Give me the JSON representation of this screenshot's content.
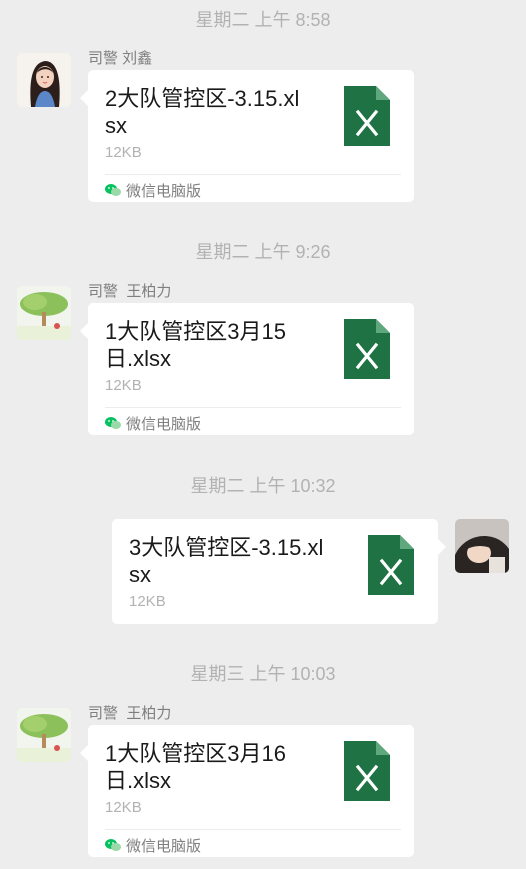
{
  "messages": [
    {
      "timestamp": "星期二 上午 8:58",
      "sender": "司警 刘鑫",
      "file_name": "2大队管控区-3.15.xlsx",
      "file_size": "12KB",
      "source": "微信电脑版",
      "direction": "incoming",
      "avatar": "avatar-woman-illustration"
    },
    {
      "timestamp": "星期二 上午 9:26",
      "sender": "司警  王柏力",
      "file_name": "1大队管控区3月15日.xlsx",
      "file_size": "12KB",
      "source": "微信电脑版",
      "direction": "incoming",
      "avatar": "avatar-tree-landscape"
    },
    {
      "timestamp": "星期二 上午 10:32",
      "file_name": "3大队管控区-3.15.xlsx",
      "file_size": "12KB",
      "direction": "outgoing",
      "avatar": "avatar-child-photo"
    },
    {
      "timestamp": "星期三 上午 10:03",
      "sender": "司警  王柏力",
      "file_name": "1大队管控区3月16日.xlsx",
      "file_size": "12KB",
      "source": "微信电脑版",
      "direction": "incoming",
      "avatar": "avatar-tree-landscape"
    }
  ],
  "colors": {
    "background": "#ededed",
    "bubble": "#ffffff",
    "excel_green": "#1f7244",
    "wechat_green": "#07c160",
    "muted_text": "#b2b2b2"
  }
}
